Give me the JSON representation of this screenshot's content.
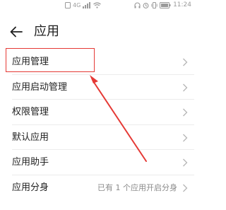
{
  "status_bar": {
    "carrier_text": "4G",
    "battery_text": "100",
    "time": "11:24"
  },
  "header": {
    "title": "应用"
  },
  "list": [
    {
      "label": "应用管理",
      "value": ""
    },
    {
      "label": "应用启动管理",
      "value": ""
    },
    {
      "label": "权限管理",
      "value": ""
    },
    {
      "label": "默认应用",
      "value": ""
    },
    {
      "label": "应用助手",
      "value": ""
    },
    {
      "label": "应用分身",
      "value": "已有 1 个应用开启分身"
    }
  ],
  "colors": {
    "highlight": "#e53935",
    "arrow": "#e53935",
    "text": "#1f1f1f",
    "secondary_text": "#8a8a8a"
  },
  "icons": {
    "back": "arrow-left-icon",
    "chevron": "chevron-right-icon"
  }
}
